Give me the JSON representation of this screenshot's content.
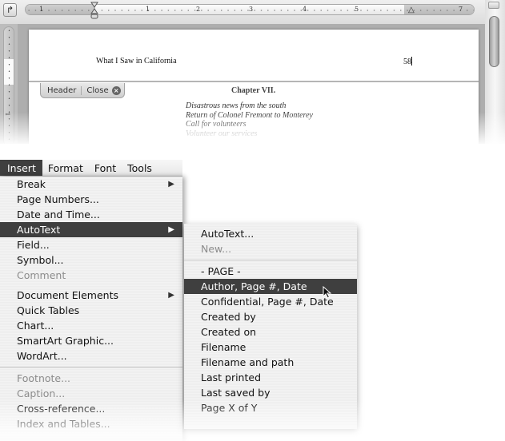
{
  "document": {
    "ruler": {
      "tab_selector_icon": "tab-stop-selector-icon",
      "numbers": [
        "1",
        "1",
        "2",
        "3",
        "4",
        "5",
        "7"
      ],
      "vertical_number": "1"
    },
    "header": {
      "title": "What I Saw in California",
      "page_number": "58"
    },
    "header_tab": {
      "label": "Header",
      "close_label": "Close"
    },
    "body": {
      "chapter_title": "Chapter VII.",
      "summary_lines": [
        "Disastrous news from the south",
        "Return of Colonel Fremont to Monterey",
        "Call for volunteers",
        "Volunteer our services"
      ]
    }
  },
  "menubar": {
    "items": [
      "Insert",
      "Format",
      "Font",
      "Tools"
    ],
    "active": "Insert"
  },
  "insert_menu": {
    "items": [
      {
        "label": "Break",
        "submenu": true,
        "disabled": false
      },
      {
        "label": "Page Numbers...",
        "submenu": false,
        "disabled": false
      },
      {
        "label": "Date and Time...",
        "submenu": false,
        "disabled": false
      },
      {
        "label": "AutoText",
        "submenu": true,
        "disabled": false,
        "highlighted": true
      },
      {
        "label": "Field...",
        "submenu": false,
        "disabled": false
      },
      {
        "label": "Symbol...",
        "submenu": false,
        "disabled": false
      },
      {
        "label": "Comment",
        "submenu": false,
        "disabled": true
      },
      {
        "label": "Document Elements",
        "submenu": true,
        "disabled": false
      },
      {
        "label": "Quick Tables",
        "submenu": false,
        "disabled": false
      },
      {
        "label": "Chart...",
        "submenu": false,
        "disabled": false
      },
      {
        "label": "SmartArt Graphic...",
        "submenu": false,
        "disabled": false
      },
      {
        "label": "WordArt...",
        "submenu": false,
        "disabled": false
      },
      {
        "label": "Footnote...",
        "submenu": false,
        "disabled": true
      },
      {
        "label": "Caption...",
        "submenu": false,
        "disabled": true
      },
      {
        "label": "Cross-reference...",
        "submenu": false,
        "disabled": false
      },
      {
        "label": "Index and Tables...",
        "submenu": false,
        "disabled": false
      }
    ]
  },
  "autotext_menu": {
    "items": [
      {
        "label": "AutoText...",
        "disabled": false
      },
      {
        "label": "New...",
        "disabled": true
      },
      {
        "label": "- PAGE -",
        "disabled": false
      },
      {
        "label": "Author, Page #, Date",
        "disabled": false,
        "highlighted": true
      },
      {
        "label": "Confidential, Page #, Date",
        "disabled": false
      },
      {
        "label": "Created by",
        "disabled": false
      },
      {
        "label": "Created on",
        "disabled": false
      },
      {
        "label": "Filename",
        "disabled": false
      },
      {
        "label": "Filename and path",
        "disabled": false
      },
      {
        "label": "Last printed",
        "disabled": false
      },
      {
        "label": "Last saved by",
        "disabled": false
      },
      {
        "label": "Page X of Y",
        "disabled": false
      }
    ]
  },
  "colors": {
    "menu_highlight": "#3f3f3f",
    "menu_text": "#111111",
    "menu_disabled": "#8c8c8c"
  }
}
